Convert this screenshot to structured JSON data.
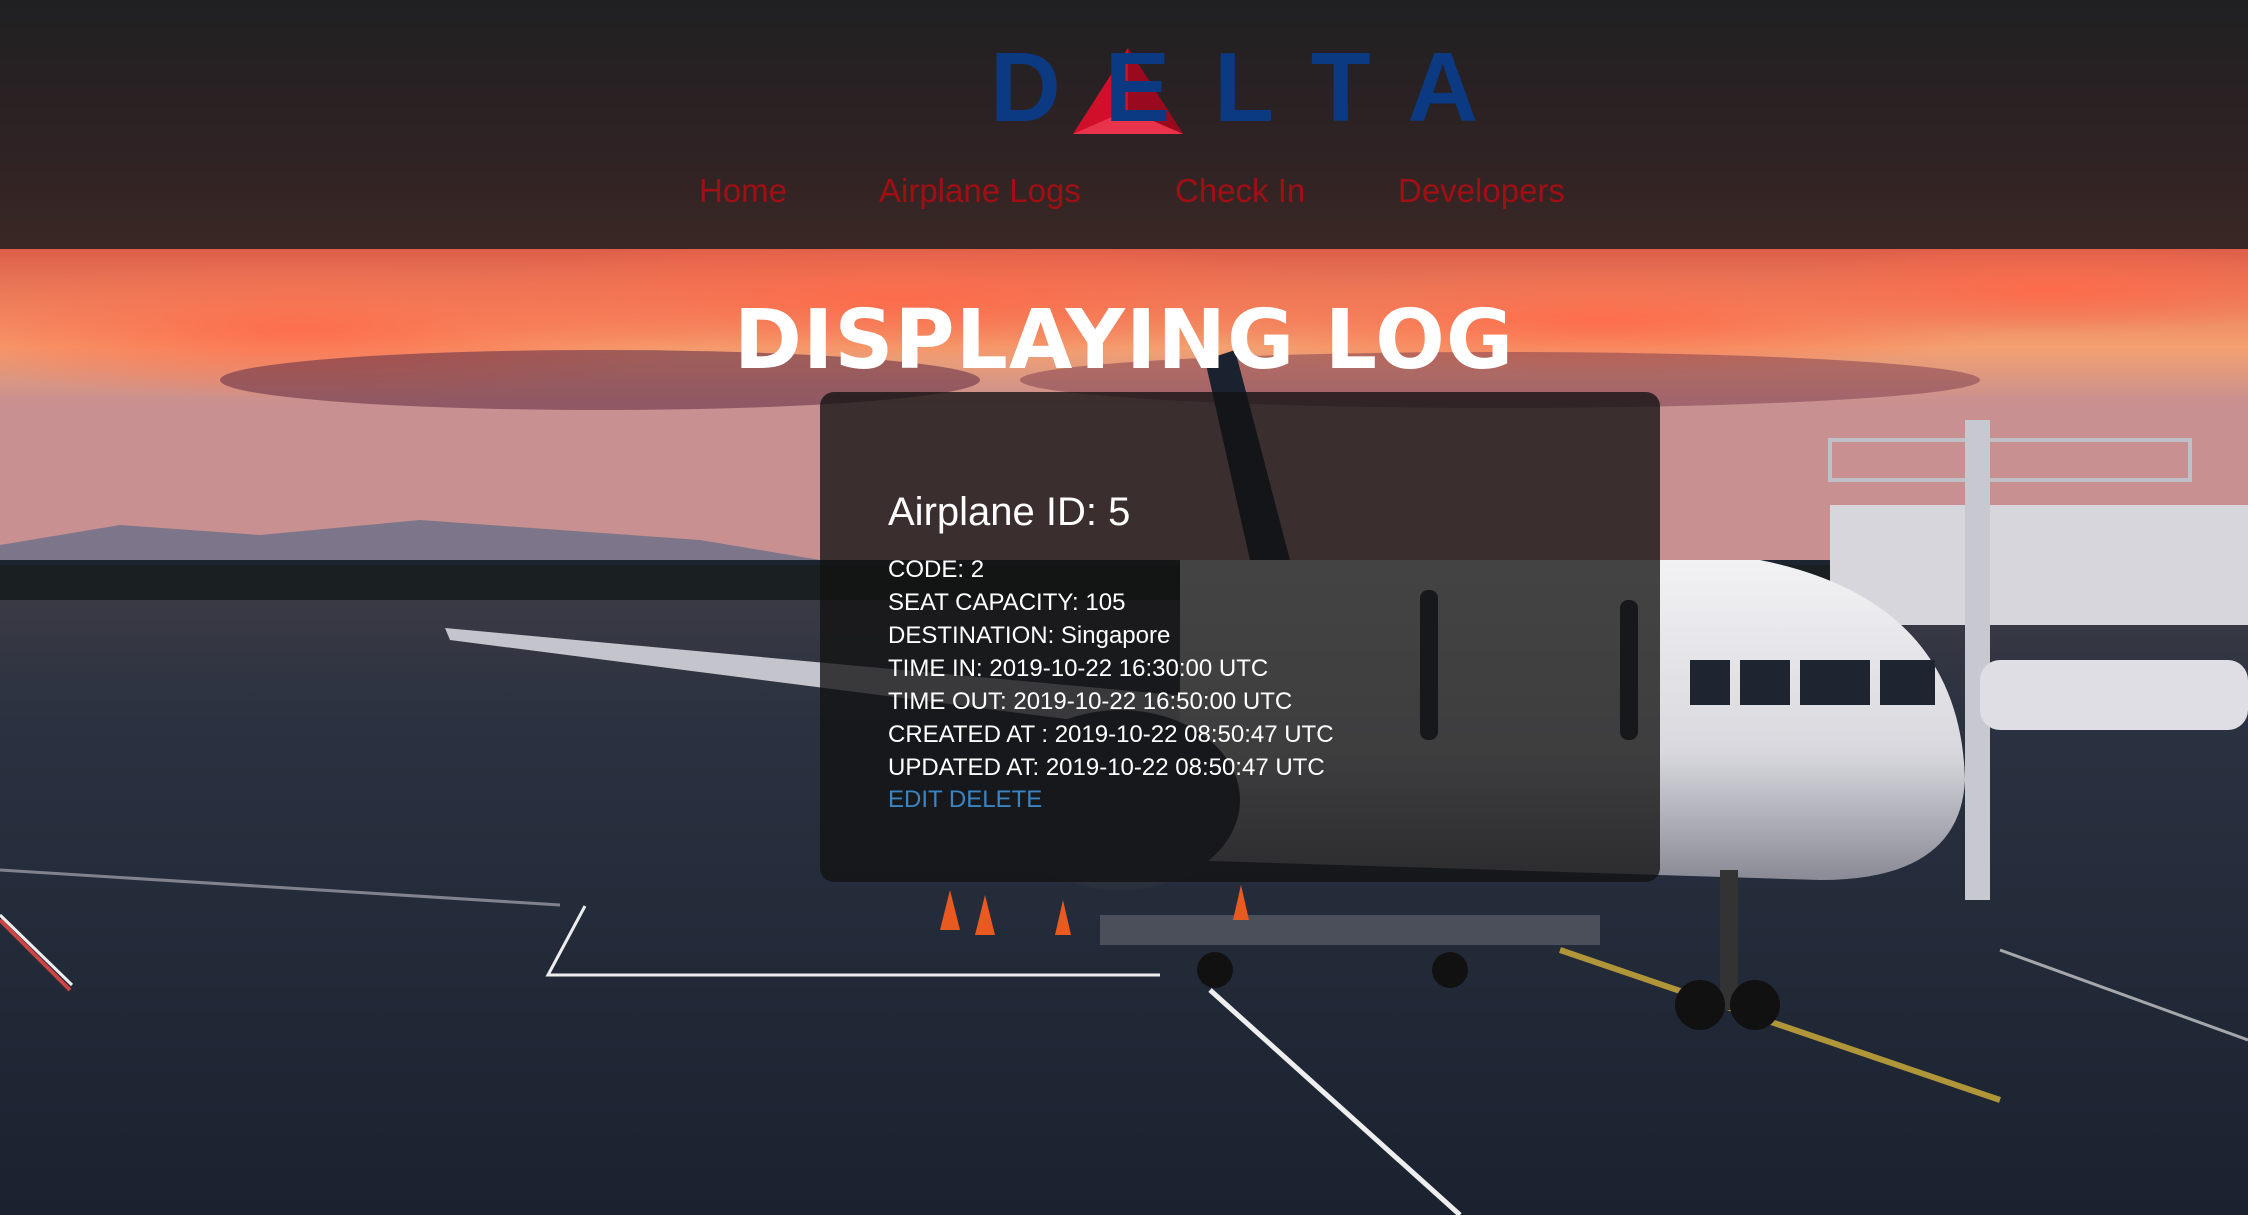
{
  "brand": {
    "name": "DELTA",
    "colors": {
      "logo_red": "#d0102a",
      "logo_blue": "#0b3a82",
      "nav_red": "#a10f14",
      "link_blue": "#3a84c4"
    }
  },
  "nav": {
    "items": [
      {
        "label": "Home"
      },
      {
        "label": "Airplane Logs"
      },
      {
        "label": "Check In"
      },
      {
        "label": "Developers"
      }
    ]
  },
  "main": {
    "title": "DISPLAYING LOG",
    "log": {
      "heading": "Airplane ID: 5",
      "fields": [
        {
          "label": "CODE:",
          "value": "2"
        },
        {
          "label": "SEAT CAPACITY:",
          "value": "105"
        },
        {
          "label": "DESTINATION:",
          "value": "Singapore"
        },
        {
          "label": "TIME IN:",
          "value": "2019-10-22 16:30:00 UTC"
        },
        {
          "label": "TIME OUT:",
          "value": "2019-10-22 16:50:00 UTC"
        },
        {
          "label": "CREATED AT :",
          "value": "2019-10-22 08:50:47 UTC"
        },
        {
          "label": "UPDATED AT:",
          "value": "2019-10-22 08:50:47 UTC"
        }
      ],
      "actions": {
        "edit_label": "EDIT",
        "delete_label": "DELETE"
      }
    }
  }
}
